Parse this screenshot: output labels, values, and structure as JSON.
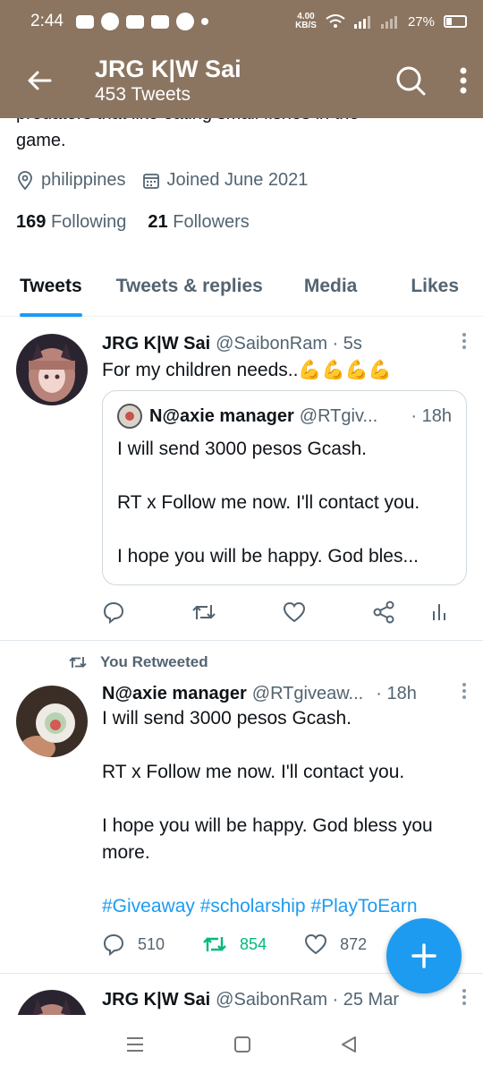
{
  "status": {
    "time": "2:44",
    "speed_value": "4.00",
    "speed_unit": "KB/S",
    "battery": "27%"
  },
  "header": {
    "name": "JRG K|W Sai",
    "tweet_count": "453 Tweets"
  },
  "profile": {
    "bio_cut": "predators that like eating small fishes in the",
    "bio_end": "game.",
    "location": "philippines",
    "joined": "Joined June 2021",
    "following_count": "169",
    "following_label": "Following",
    "followers_count": "21",
    "followers_label": "Followers"
  },
  "tabs": [
    "Tweets",
    "Tweets & replies",
    "Media",
    "Likes"
  ],
  "tweet1": {
    "name": "JRG K|W Sai",
    "handle_time": "@SaibonRam · 5s",
    "text": "For my children needs..💪💪💪💪",
    "quote": {
      "name": "N@axie manager",
      "handle": "@RTgiv...",
      "time": "· 18h",
      "line1": "I will send 3000 pesos Gcash.",
      "line2": "RT x Follow me now. I'll contact you.",
      "line3": "I hope you will be happy. God bles..."
    }
  },
  "tweet2": {
    "retweet_label": "You Retweeted",
    "name": "N@axie manager",
    "handle": "@RTgiveaw...",
    "time": "· 18h",
    "line1": "I will send 3000 pesos Gcash.",
    "line2": "RT x Follow me now. I'll contact you.",
    "line3": "I hope you will be happy. God bless you more.",
    "hashtags": "#Giveaway #scholarship #PlayToEarn",
    "replies": "510",
    "retweets": "854",
    "likes": "872"
  },
  "tweet3": {
    "name": "JRG K|W Sai",
    "handle_time": "@SaibonRam · 25 Mar"
  },
  "colors": {
    "header_bg": "#8b7560",
    "accent": "#1d9bf0",
    "retweet_green": "#00ba7c"
  }
}
